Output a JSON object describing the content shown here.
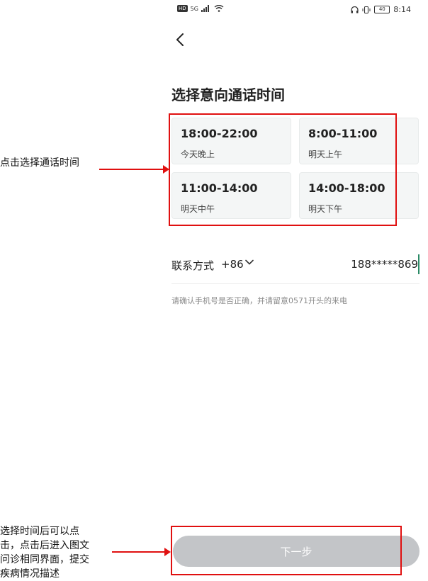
{
  "status_bar": {
    "network": "5G",
    "time": "8:14",
    "battery": "40"
  },
  "title": "选择意向通话时间",
  "slots": [
    {
      "time": "18:00-22:00",
      "day": "今天晚上"
    },
    {
      "time": "8:00-11:00",
      "day": "明天上午"
    },
    {
      "time": "11:00-14:00",
      "day": "明天中午"
    },
    {
      "time": "14:00-18:00",
      "day": "明天下午"
    }
  ],
  "contact": {
    "label": "联系方式",
    "country_code": "+86",
    "phone": "188*****869"
  },
  "hint": "请确认手机号是否正确，并请留意0571开头的来电",
  "next_button": "下一步",
  "annotations": {
    "slots_note": "点击选择通话时间",
    "button_note_lines": [
      "选择时间后可以点",
      "击，点击后进入图文",
      "问诊相同界面，提交",
      "疾病情况描述"
    ]
  },
  "colors": {
    "annotation_red": "#e01010",
    "button_disabled": "#c3c5c8",
    "cursor_accent": "#2b8a66"
  }
}
